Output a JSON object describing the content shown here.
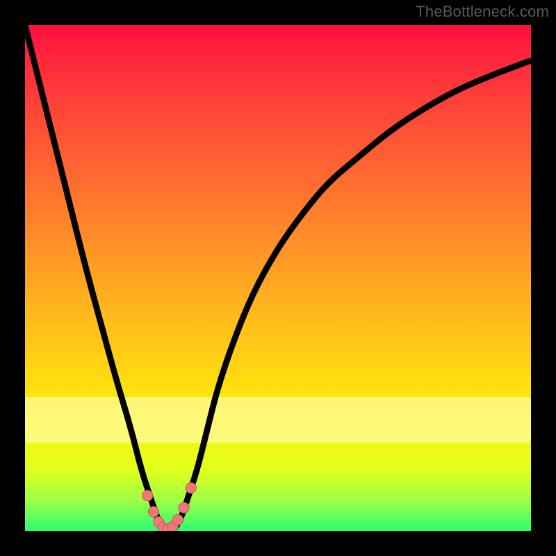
{
  "watermark": "TheBottleneck.com",
  "colors": {
    "curve": "#000000",
    "marker_fill": "#f07878",
    "marker_stroke": "#c94f4f",
    "gradient_top": "#ff0e3f",
    "gradient_bottom": "#2aff70",
    "frame": "#000000"
  },
  "chart_data": {
    "type": "line",
    "title": "",
    "xlabel": "",
    "ylabel": "",
    "xlim": [
      0,
      100
    ],
    "ylim": [
      0,
      100
    ],
    "grid": false,
    "legend": false,
    "series": [
      {
        "name": "bottleneck-curve",
        "x": [
          0,
          3,
          6,
          9,
          12,
          15,
          18,
          21,
          23,
          25,
          26,
          27,
          28,
          29,
          30,
          31,
          32,
          34,
          36,
          38,
          41,
          45,
          50,
          55,
          60,
          66,
          72,
          78,
          85,
          92,
          100
        ],
        "y": [
          100,
          88,
          76,
          64,
          52,
          41,
          30,
          20,
          12,
          6,
          3,
          1,
          0,
          0,
          1,
          3,
          6,
          12,
          20,
          28,
          37,
          47,
          56,
          63,
          69,
          74,
          79,
          83,
          87,
          90,
          93
        ]
      }
    ],
    "markers": {
      "name": "valley-markers",
      "x": [
        24.2,
        25.4,
        26.4,
        27.3,
        28.2,
        29.2,
        30.2,
        31.4,
        32.8
      ],
      "y": [
        7.0,
        3.8,
        1.8,
        0.6,
        0.4,
        0.9,
        2.2,
        4.6,
        8.5
      ]
    }
  }
}
